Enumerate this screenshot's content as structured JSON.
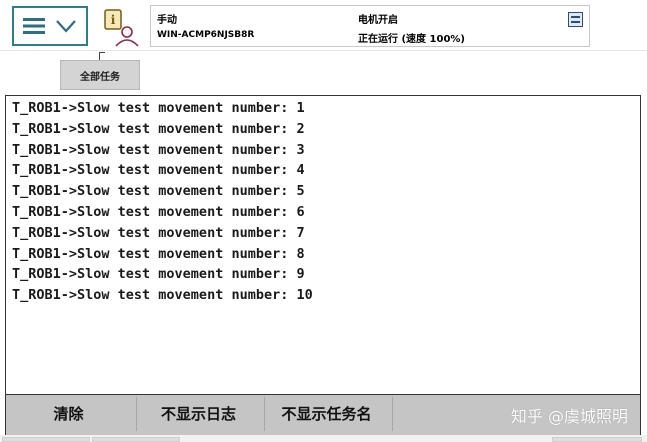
{
  "header": {
    "mode": "手动",
    "controller_name": "WIN-ACMP6NJSB8R",
    "motor_state": "电机开启",
    "run_state": "正在运行 (速度 100%)"
  },
  "icons": {
    "menu": "hamburger-icon",
    "menu_dropdown": "chevron-down-icon",
    "info": "info-person-icon",
    "status": "status-window-icon"
  },
  "tabs": [
    {
      "label": "全部任务"
    }
  ],
  "log": {
    "lines": [
      "T_ROB1->Slow test movement number: 1",
      "T_ROB1->Slow test movement number: 2",
      "T_ROB1->Slow test movement number: 3",
      "T_ROB1->Slow test movement number: 4",
      "T_ROB1->Slow test movement number: 5",
      "T_ROB1->Slow test movement number: 6",
      "T_ROB1->Slow test movement number: 7",
      "T_ROB1->Slow test movement number: 8",
      "T_ROB1->Slow test movement number: 9",
      "T_ROB1->Slow test movement number: 10"
    ]
  },
  "toolbar": {
    "clear_label": "清除",
    "hide_log_label": "不显示日志",
    "hide_task_label": "不显示任务名"
  },
  "watermark": "知乎 @虞城照明",
  "colors": {
    "accent": "#2e7f8c",
    "toolbar_bg": "#c5c5c5",
    "tab_bg": "#d4d4d4"
  }
}
